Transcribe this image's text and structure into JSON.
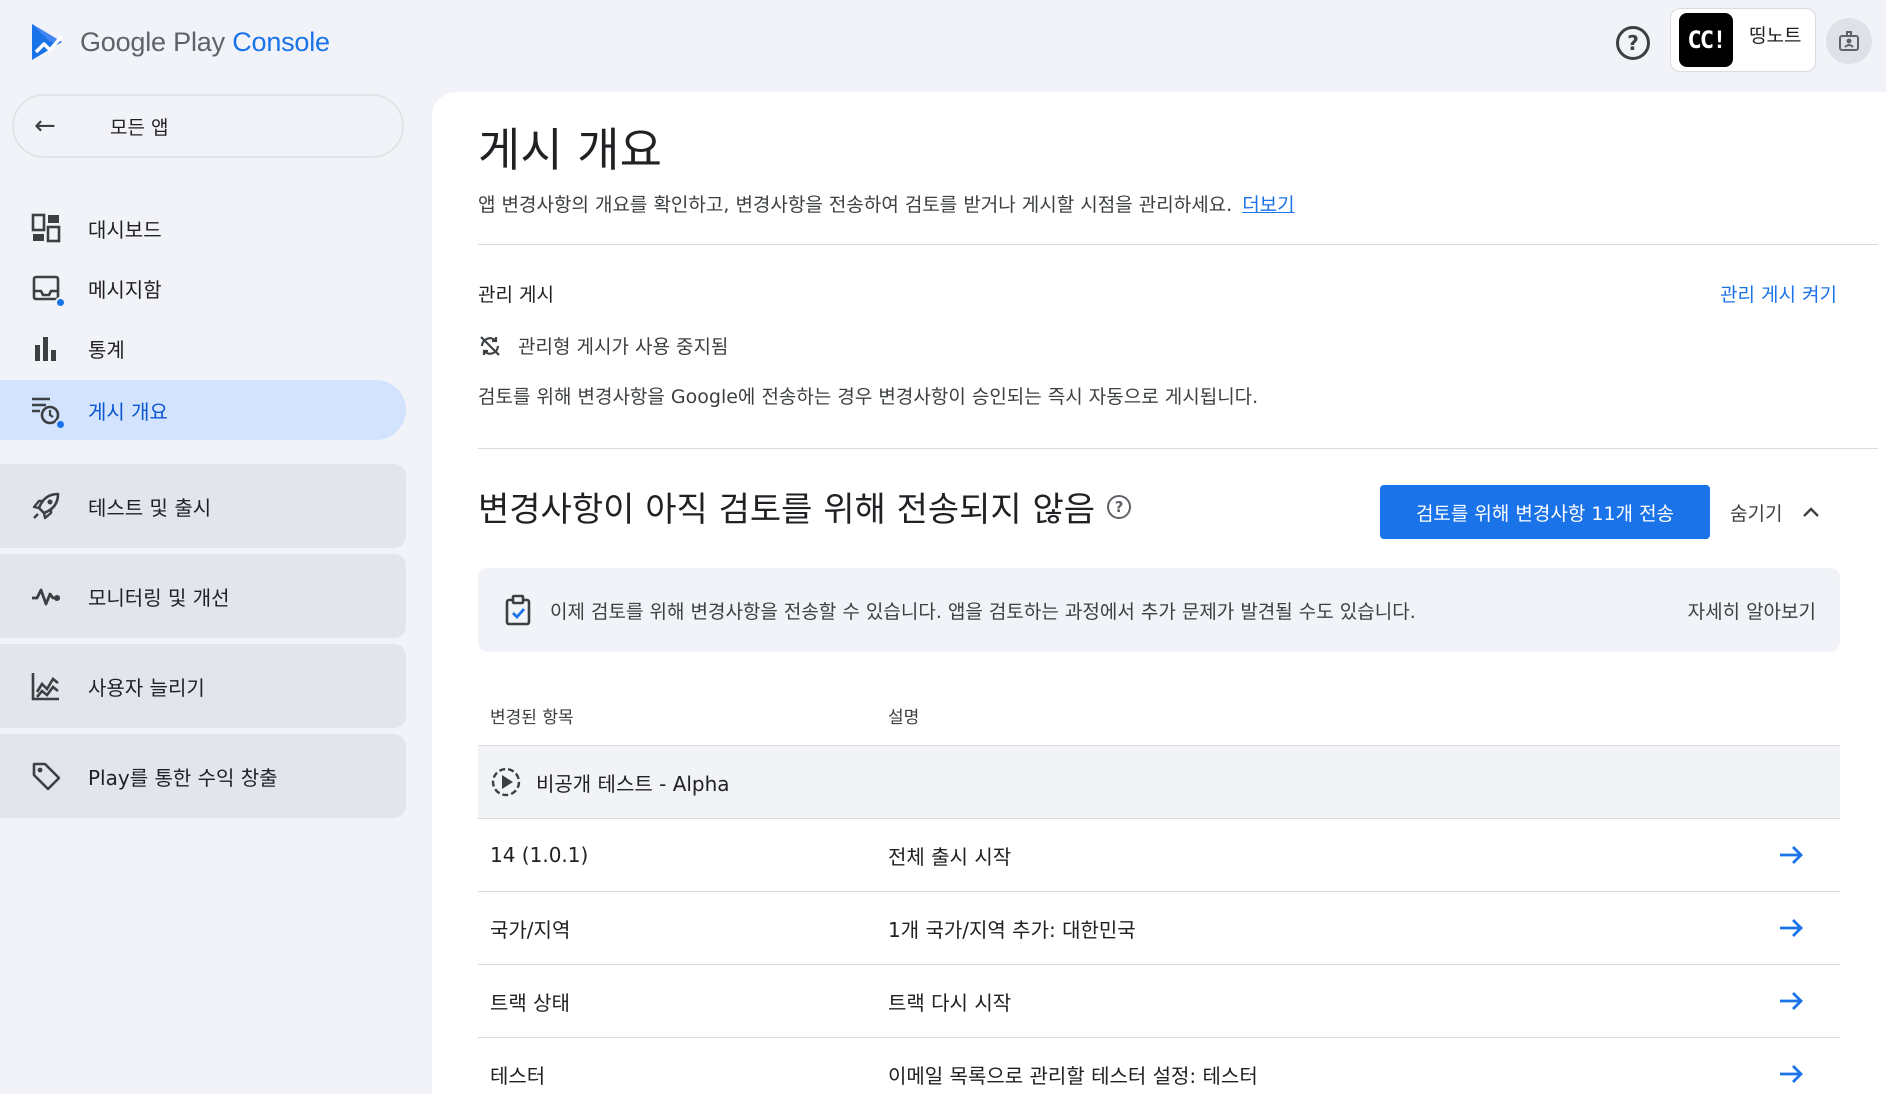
{
  "app": {
    "logo_brand": "Google Play",
    "logo_product": "Console"
  },
  "topbar": {
    "help_icon": "help-circle-icon",
    "account_avatar_text": "CC!",
    "account_name": "띵노트",
    "developer_icon": "developer-account-icon"
  },
  "sidebar": {
    "all_apps_label": "모든 앱",
    "items": [
      {
        "label": "대시보드",
        "icon": "dashboard-icon"
      },
      {
        "label": "메시지함",
        "icon": "inbox-icon"
      },
      {
        "label": "통계",
        "icon": "bar-chart-icon"
      },
      {
        "label": "게시 개요",
        "icon": "publishing-overview-icon"
      }
    ],
    "groups": [
      {
        "label": "테스트 및 출시",
        "icon": "rocket-icon"
      },
      {
        "label": "모니터링 및 개선",
        "icon": "pulse-icon"
      },
      {
        "label": "사용자 늘리기",
        "icon": "growth-chart-icon"
      },
      {
        "label": "Play를 통한 수익 창출",
        "icon": "tag-icon"
      }
    ]
  },
  "main": {
    "title": "게시 개요",
    "description": "앱 변경사항의 개요를 확인하고, 변경사항을 전송하여 검토를 받거나 게시할 시점을 관리하세요.",
    "description_link": "더보기",
    "managed_publishing": {
      "title": "관리 게시",
      "toggle_label": "관리 게시 켜기",
      "status": "관리형 게시가 사용 중지됨",
      "info": "검토를 위해 변경사항을 Google에 전송하는 경우 변경사항이 승인되는 즉시 자동으로 게시됩니다."
    },
    "changes": {
      "title": "변경사항이 아직 검토를 위해 전송되지 않음",
      "help_icon": "?",
      "send_button": "검토를 위해 변경사항 11개 전송",
      "hide_button": "숨기기",
      "banner_text": "이제 검토를 위해 변경사항을 전송할 수 있습니다. 앱을 검토하는 과정에서 추가 문제가 발견될 수도 있습니다.",
      "banner_link": "자세히 알아보기",
      "table": {
        "headers": [
          "변경된 항목",
          "설명"
        ],
        "group_label": "비공개 테스트 - Alpha",
        "rows": [
          {
            "item": "14 (1.0.1)",
            "description": "전체 출시 시작"
          },
          {
            "item": "국가/지역",
            "description": "1개 국가/지역 추가: 대한민국"
          },
          {
            "item": "트랙 상태",
            "description": "트랙 다시 시작"
          },
          {
            "item": "테스터",
            "description": "이메일 목록으로 관리할 테스터 설정: 테스터"
          }
        ]
      }
    }
  },
  "colors": {
    "accent": "#1a73e8",
    "active_nav_bg": "#d3e3fd",
    "page_bg": "#f1f3f8"
  }
}
